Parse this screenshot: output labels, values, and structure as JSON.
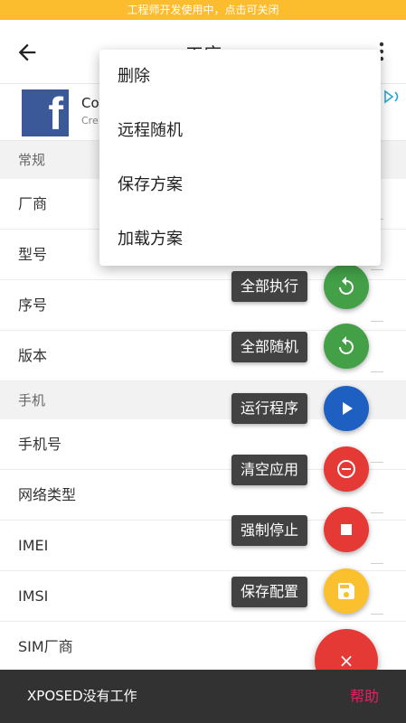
{
  "banner": {
    "text": "工程师开发使用中，点击可关闭"
  },
  "appbar": {
    "title": "工序",
    "back_icon": "arrow-left-icon",
    "overflow_icon": "more-vertical-icon"
  },
  "ad": {
    "title": "Co",
    "subtitle": "Cre",
    "logo": "facebook-logo"
  },
  "sections": {
    "general": "常规",
    "general_rows": [
      "厂商",
      "型号",
      "序号",
      "版本"
    ],
    "phone": "手机",
    "phone_rows": [
      "手机号",
      "网络类型",
      "IMEI",
      "IMSI",
      "SIM厂商"
    ]
  },
  "menu": {
    "items": [
      "删除",
      "远程随机",
      "保存方案",
      "加载方案"
    ]
  },
  "fabs": [
    {
      "label": "全部执行",
      "icon": "refresh-icon",
      "color": "#43a047"
    },
    {
      "label": "全部随机",
      "icon": "refresh-icon",
      "color": "#43a047"
    },
    {
      "label": "运行程序",
      "icon": "play-icon",
      "color": "#1e60c2"
    },
    {
      "label": "清空应用",
      "icon": "remove-circle-icon",
      "color": "#e53935"
    },
    {
      "label": "强制停止",
      "icon": "stop-icon",
      "color": "#e53935"
    },
    {
      "label": "保存配置",
      "icon": "save-icon",
      "color": "#fbc02d"
    }
  ],
  "fab_main": {
    "label": "×",
    "icon": "close-icon",
    "color": "#e53935"
  },
  "bottom_bar": {
    "status": "XPOSED没有工作",
    "help": "帮助"
  },
  "colors": {
    "banner": "#fbbd2d",
    "accent_help": "#e91e63",
    "bottom_bar": "#323232"
  }
}
